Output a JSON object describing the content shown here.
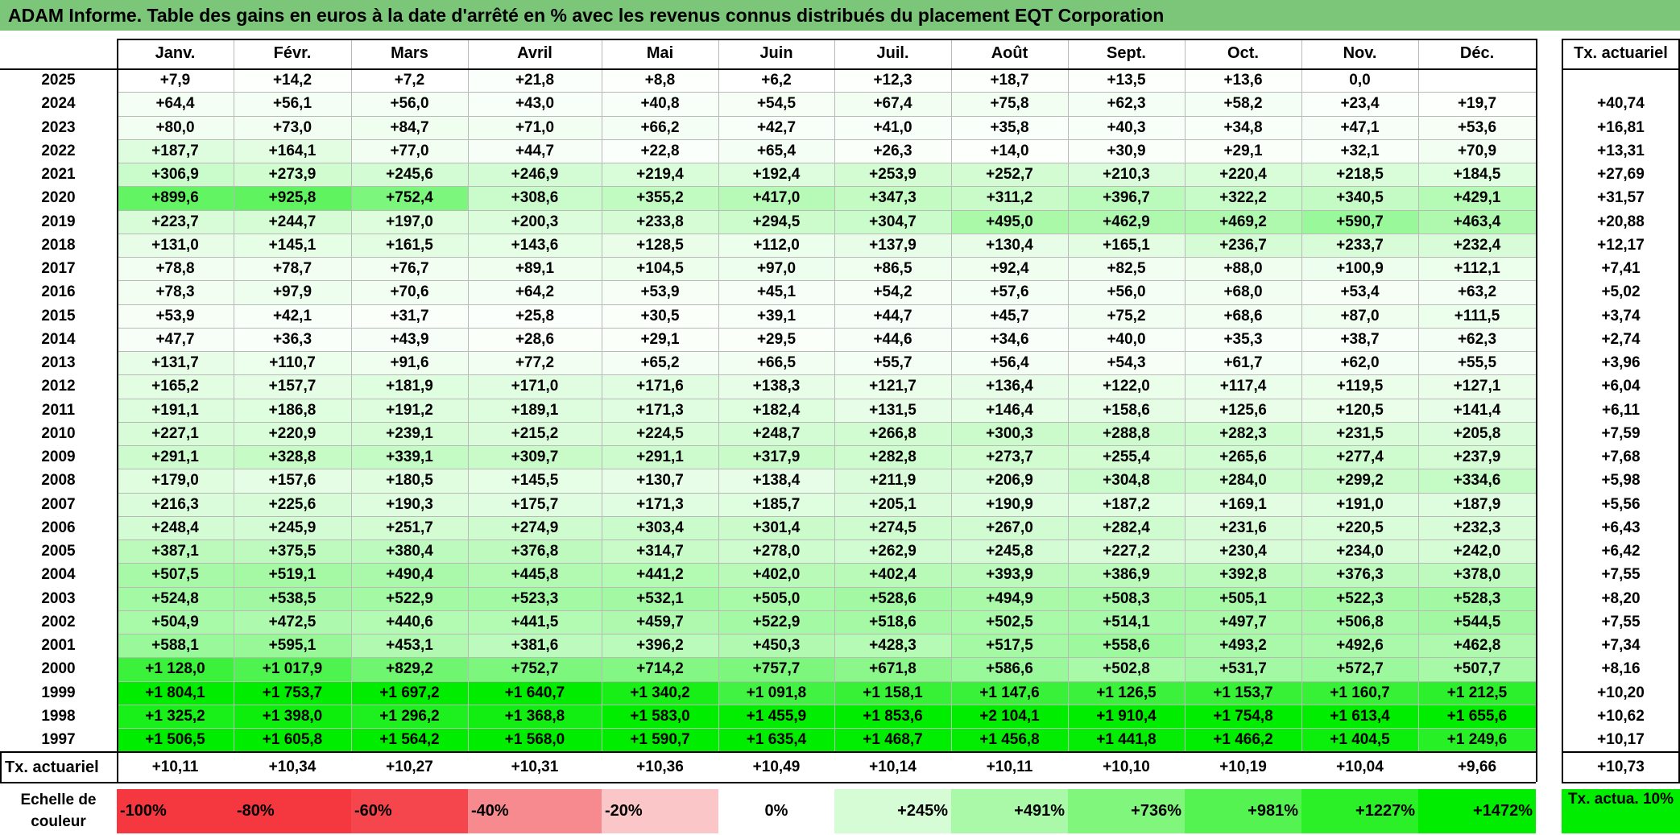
{
  "title": "ADAM Informe. Table des gains en euros à la date d'arrêté en % avec les revenus connus distribués du placement EQT Corporation",
  "months": [
    "Janv.",
    "Févr.",
    "Mars",
    "Avril",
    "Mai",
    "Juin",
    "Juil.",
    "Août",
    "Sept.",
    "Oct.",
    "Nov.",
    "Déc."
  ],
  "rate_header": "Tx. actuariel",
  "rows": [
    {
      "year": "2025",
      "values": [
        "+7,9",
        "+14,2",
        "+7,2",
        "+21,8",
        "+8,8",
        "+6,2",
        "+12,3",
        "+18,7",
        "+13,5",
        "+13,6",
        "0,0",
        ""
      ],
      "rate": ""
    },
    {
      "year": "2024",
      "values": [
        "+64,4",
        "+56,1",
        "+56,0",
        "+43,0",
        "+40,8",
        "+54,5",
        "+67,4",
        "+75,8",
        "+62,3",
        "+58,2",
        "+23,4",
        "+19,7"
      ],
      "rate": "+40,74"
    },
    {
      "year": "2023",
      "values": [
        "+80,0",
        "+73,0",
        "+84,7",
        "+71,0",
        "+66,2",
        "+42,7",
        "+41,0",
        "+35,8",
        "+40,3",
        "+34,8",
        "+47,1",
        "+53,6"
      ],
      "rate": "+16,81"
    },
    {
      "year": "2022",
      "values": [
        "+187,7",
        "+164,1",
        "+77,0",
        "+44,7",
        "+22,8",
        "+65,4",
        "+26,3",
        "+14,0",
        "+30,9",
        "+29,1",
        "+32,1",
        "+70,9"
      ],
      "rate": "+13,31"
    },
    {
      "year": "2021",
      "values": [
        "+306,9",
        "+273,9",
        "+245,6",
        "+246,9",
        "+219,4",
        "+192,4",
        "+253,9",
        "+252,7",
        "+210,3",
        "+220,4",
        "+218,5",
        "+184,5"
      ],
      "rate": "+27,69"
    },
    {
      "year": "2020",
      "values": [
        "+899,6",
        "+925,8",
        "+752,4",
        "+308,6",
        "+355,2",
        "+417,0",
        "+347,3",
        "+311,2",
        "+396,7",
        "+322,2",
        "+340,5",
        "+429,1"
      ],
      "rate": "+31,57"
    },
    {
      "year": "2019",
      "values": [
        "+223,7",
        "+244,7",
        "+197,0",
        "+200,3",
        "+233,8",
        "+294,5",
        "+304,7",
        "+495,0",
        "+462,9",
        "+469,2",
        "+590,7",
        "+463,4"
      ],
      "rate": "+20,88"
    },
    {
      "year": "2018",
      "values": [
        "+131,0",
        "+145,1",
        "+161,5",
        "+143,6",
        "+128,5",
        "+112,0",
        "+137,9",
        "+130,4",
        "+165,1",
        "+236,7",
        "+233,7",
        "+232,4"
      ],
      "rate": "+12,17"
    },
    {
      "year": "2017",
      "values": [
        "+78,8",
        "+78,7",
        "+76,7",
        "+89,1",
        "+104,5",
        "+97,0",
        "+86,5",
        "+92,4",
        "+82,5",
        "+88,0",
        "+100,9",
        "+112,1"
      ],
      "rate": "+7,41"
    },
    {
      "year": "2016",
      "values": [
        "+78,3",
        "+97,9",
        "+70,6",
        "+64,2",
        "+53,9",
        "+45,1",
        "+54,2",
        "+57,6",
        "+56,0",
        "+68,0",
        "+53,4",
        "+63,2"
      ],
      "rate": "+5,02"
    },
    {
      "year": "2015",
      "values": [
        "+53,9",
        "+42,1",
        "+31,7",
        "+25,8",
        "+30,5",
        "+39,1",
        "+44,7",
        "+45,7",
        "+75,2",
        "+68,6",
        "+87,0",
        "+111,5"
      ],
      "rate": "+3,74"
    },
    {
      "year": "2014",
      "values": [
        "+47,7",
        "+36,3",
        "+43,9",
        "+28,6",
        "+29,1",
        "+29,5",
        "+44,6",
        "+34,6",
        "+40,0",
        "+35,3",
        "+38,7",
        "+62,3"
      ],
      "rate": "+2,74"
    },
    {
      "year": "2013",
      "values": [
        "+131,7",
        "+110,7",
        "+91,6",
        "+77,2",
        "+65,2",
        "+66,5",
        "+55,7",
        "+56,4",
        "+54,3",
        "+61,7",
        "+62,0",
        "+55,5"
      ],
      "rate": "+3,96"
    },
    {
      "year": "2012",
      "values": [
        "+165,2",
        "+157,7",
        "+181,9",
        "+171,0",
        "+171,6",
        "+138,3",
        "+121,7",
        "+136,4",
        "+122,0",
        "+117,4",
        "+119,5",
        "+127,1"
      ],
      "rate": "+6,04"
    },
    {
      "year": "2011",
      "values": [
        "+191,1",
        "+186,8",
        "+191,2",
        "+189,1",
        "+171,3",
        "+182,4",
        "+131,5",
        "+146,4",
        "+158,6",
        "+125,6",
        "+120,5",
        "+141,4"
      ],
      "rate": "+6,11"
    },
    {
      "year": "2010",
      "values": [
        "+227,1",
        "+220,9",
        "+239,1",
        "+215,2",
        "+224,5",
        "+248,7",
        "+266,8",
        "+300,3",
        "+288,8",
        "+282,3",
        "+231,5",
        "+205,8"
      ],
      "rate": "+7,59"
    },
    {
      "year": "2009",
      "values": [
        "+291,1",
        "+328,8",
        "+339,1",
        "+309,7",
        "+291,1",
        "+317,9",
        "+282,8",
        "+273,7",
        "+255,4",
        "+265,6",
        "+277,4",
        "+237,9"
      ],
      "rate": "+7,68"
    },
    {
      "year": "2008",
      "values": [
        "+179,0",
        "+157,6",
        "+180,5",
        "+145,5",
        "+130,7",
        "+138,4",
        "+211,9",
        "+206,9",
        "+304,8",
        "+284,0",
        "+299,2",
        "+334,6"
      ],
      "rate": "+5,98"
    },
    {
      "year": "2007",
      "values": [
        "+216,3",
        "+225,6",
        "+190,3",
        "+175,7",
        "+171,3",
        "+185,7",
        "+205,1",
        "+190,9",
        "+187,2",
        "+169,1",
        "+191,0",
        "+187,9"
      ],
      "rate": "+5,56"
    },
    {
      "year": "2006",
      "values": [
        "+248,4",
        "+245,9",
        "+251,7",
        "+274,9",
        "+303,4",
        "+301,4",
        "+274,5",
        "+267,0",
        "+282,4",
        "+231,6",
        "+220,5",
        "+232,3"
      ],
      "rate": "+6,43"
    },
    {
      "year": "2005",
      "values": [
        "+387,1",
        "+375,5",
        "+380,4",
        "+376,8",
        "+314,7",
        "+278,0",
        "+262,9",
        "+245,8",
        "+227,2",
        "+230,4",
        "+234,0",
        "+242,0"
      ],
      "rate": "+6,42"
    },
    {
      "year": "2004",
      "values": [
        "+507,5",
        "+519,1",
        "+490,4",
        "+445,8",
        "+441,2",
        "+402,0",
        "+402,4",
        "+393,9",
        "+386,9",
        "+392,8",
        "+376,3",
        "+378,0"
      ],
      "rate": "+7,55"
    },
    {
      "year": "2003",
      "values": [
        "+524,8",
        "+538,5",
        "+522,9",
        "+523,3",
        "+532,1",
        "+505,0",
        "+528,6",
        "+494,9",
        "+508,3",
        "+505,1",
        "+522,3",
        "+528,3"
      ],
      "rate": "+8,20"
    },
    {
      "year": "2002",
      "values": [
        "+504,9",
        "+472,5",
        "+440,6",
        "+441,5",
        "+459,7",
        "+522,9",
        "+518,6",
        "+502,5",
        "+514,1",
        "+497,7",
        "+506,8",
        "+544,5"
      ],
      "rate": "+7,55"
    },
    {
      "year": "2001",
      "values": [
        "+588,1",
        "+595,1",
        "+453,1",
        "+381,6",
        "+396,2",
        "+450,3",
        "+428,3",
        "+517,5",
        "+558,6",
        "+493,2",
        "+492,6",
        "+462,8"
      ],
      "rate": "+7,34"
    },
    {
      "year": "2000",
      "values": [
        "+1 128,0",
        "+1 017,9",
        "+829,2",
        "+752,7",
        "+714,2",
        "+757,7",
        "+671,8",
        "+586,6",
        "+502,8",
        "+531,7",
        "+572,7",
        "+507,7"
      ],
      "rate": "+8,16"
    },
    {
      "year": "1999",
      "values": [
        "+1 804,1",
        "+1 753,7",
        "+1 697,2",
        "+1 640,7",
        "+1 340,2",
        "+1 091,8",
        "+1 158,1",
        "+1 147,6",
        "+1 126,5",
        "+1 153,7",
        "+1 160,7",
        "+1 212,5"
      ],
      "rate": "+10,20"
    },
    {
      "year": "1998",
      "values": [
        "+1 325,2",
        "+1 398,0",
        "+1 296,2",
        "+1 368,8",
        "+1 583,0",
        "+1 455,9",
        "+1 853,6",
        "+2 104,1",
        "+1 910,4",
        "+1 754,8",
        "+1 613,4",
        "+1 655,6"
      ],
      "rate": "+10,62"
    },
    {
      "year": "1997",
      "values": [
        "+1 506,5",
        "+1 605,8",
        "+1 564,2",
        "+1 568,0",
        "+1 590,7",
        "+1 635,4",
        "+1 468,7",
        "+1 456,8",
        "+1 441,8",
        "+1 466,2",
        "+1 404,5",
        "+1 249,6"
      ],
      "rate": "+10,17"
    }
  ],
  "footer": {
    "label": "Tx. actuariel",
    "values": [
      "+10,11",
      "+10,34",
      "+10,27",
      "+10,31",
      "+10,36",
      "+10,49",
      "+10,14",
      "+10,11",
      "+10,10",
      "+10,19",
      "+10,04",
      "+9,66"
    ],
    "rate": "+10,73"
  },
  "scale": {
    "label": "Echelle de couleur",
    "cells": [
      {
        "text": "-100%",
        "color": "#f5373f",
        "align": "left"
      },
      {
        "text": "-80%",
        "color": "#f5373f",
        "align": "left"
      },
      {
        "text": "-60%",
        "color": "#f5454d",
        "align": "left"
      },
      {
        "text": "-40%",
        "color": "#f78a8e",
        "align": "left"
      },
      {
        "text": "-20%",
        "color": "#fbc6c8",
        "align": "left"
      },
      {
        "text": "0%",
        "color": "#ffffff",
        "align": "center"
      },
      {
        "text": "+245%",
        "color": "#d5fcd4",
        "align": "right"
      },
      {
        "text": "+491%",
        "color": "#aaf9a8",
        "align": "right"
      },
      {
        "text": "+736%",
        "color": "#80f67d",
        "align": "right"
      },
      {
        "text": "+981%",
        "color": "#55f352",
        "align": "right"
      },
      {
        "text": "+1227%",
        "color": "#2bf027",
        "align": "right"
      },
      {
        "text": "+1472%",
        "color": "#00ed00",
        "align": "right"
      }
    ],
    "rate_text": "Tx. actua. 10%",
    "rate_color": "#00ed00"
  },
  "colors": {
    "title_bar": "#7cc67a",
    "scale_max_green": "#00ed00"
  }
}
